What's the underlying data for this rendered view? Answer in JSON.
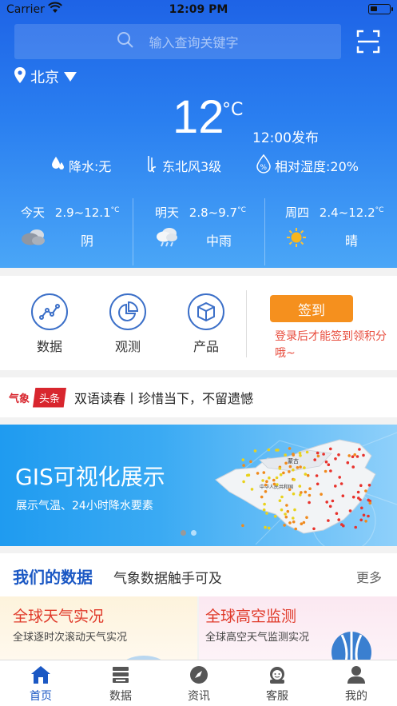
{
  "status_bar": {
    "carrier": "Carrier",
    "time": "12:09 PM"
  },
  "search": {
    "placeholder": "输入查询关键字"
  },
  "location": {
    "city": "北京"
  },
  "weather": {
    "temperature": "12",
    "unit": "°C",
    "publish_time": "12:00发布",
    "precipitation": "降水:无",
    "wind": "东北风3级",
    "humidity": "相对湿度:20%"
  },
  "forecast": [
    {
      "day": "今天",
      "range": "2.9~12.1",
      "unit": "°C",
      "desc": "阴",
      "icon": "cloudy-icon"
    },
    {
      "day": "明天",
      "range": "2.8~9.7",
      "unit": "°C",
      "desc": "中雨",
      "icon": "rain-icon"
    },
    {
      "day": "周四",
      "range": "2.4~12.2",
      "unit": "°C",
      "desc": "晴",
      "icon": "sunny-icon"
    }
  ],
  "actions": [
    {
      "label": "数据",
      "icon": "line-chart-icon"
    },
    {
      "label": "观测",
      "icon": "pie-chart-icon"
    },
    {
      "label": "产品",
      "icon": "box-icon"
    }
  ],
  "checkin": {
    "button": "签到",
    "hint": "登录后才能签到领积分哦~"
  },
  "headline": {
    "brand": "气象",
    "tag": "头条",
    "text": "双语读春丨珍惜当下，不留遗憾"
  },
  "banner": {
    "title": "GIS可视化展示",
    "subtitle": "展示气温、24小时降水要素",
    "map_label_1": "蒙古",
    "map_label_2": "中华人民共和国"
  },
  "our_data": {
    "title": "我们的数据",
    "subtitle": "气象数据触手可及",
    "more": "更多"
  },
  "cards": [
    {
      "title": "全球天气实况",
      "subtitle": "全球逐时次滚动天气实况"
    },
    {
      "title": "全球高空监测",
      "subtitle": "全球高空天气监测实况"
    }
  ],
  "tabs": [
    {
      "label": "首页",
      "icon": "home-icon"
    },
    {
      "label": "数据",
      "icon": "database-icon"
    },
    {
      "label": "资讯",
      "icon": "compass-icon"
    },
    {
      "label": "客服",
      "icon": "support-icon"
    },
    {
      "label": "我的",
      "icon": "user-icon"
    }
  ],
  "colors": {
    "primary": "#1b58c4",
    "accent": "#f5901e",
    "alert": "#d8262e"
  }
}
